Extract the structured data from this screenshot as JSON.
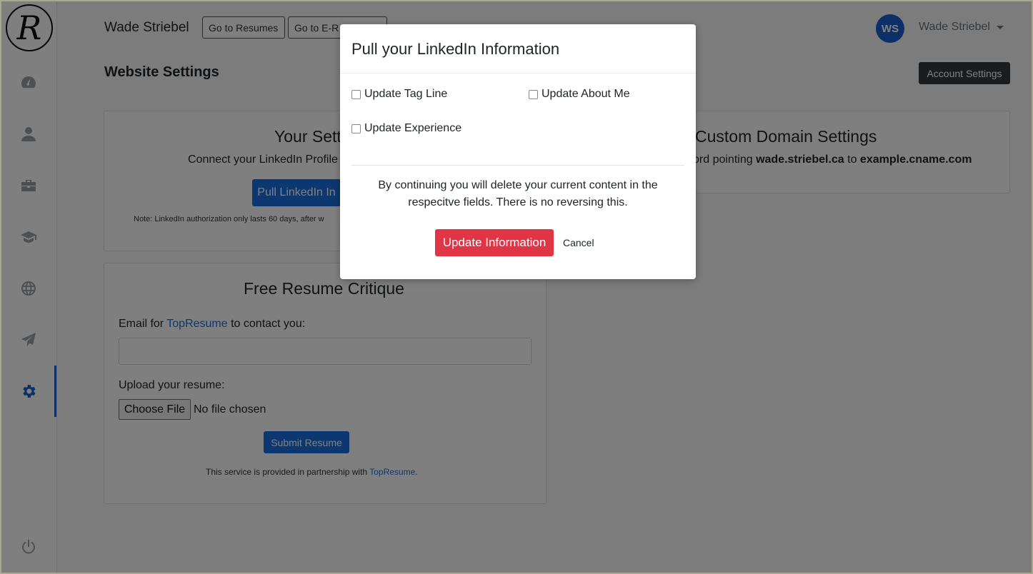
{
  "sidebar": {
    "logo_letter": "R",
    "items": [
      {
        "name": "dashboard",
        "icon": "gauge-icon"
      },
      {
        "name": "profile",
        "icon": "user-icon"
      },
      {
        "name": "experience",
        "icon": "briefcase-icon"
      },
      {
        "name": "education",
        "icon": "graduation-cap-icon"
      },
      {
        "name": "website",
        "icon": "globe-icon"
      },
      {
        "name": "send",
        "icon": "paper-plane-icon"
      },
      {
        "name": "settings",
        "icon": "gear-icon",
        "active": true
      },
      {
        "name": "logout",
        "icon": "power-icon"
      }
    ]
  },
  "header": {
    "brand": "Wade Striebel",
    "btn_resumes": "Go to Resumes",
    "btn_eresume": "Go to E-R",
    "avatar_initials": "WS",
    "user_name": "Wade Striebel"
  },
  "page": {
    "title": "Website Settings",
    "account_btn": "Account Settings"
  },
  "settings_card": {
    "title": "Your Sett",
    "text": "Connect your LinkedIn Profile",
    "button": "Pull LinkedIn In",
    "note": "Note: LinkedIn authorization only lasts 60 days, after w"
  },
  "domain_card": {
    "title": "Custom Domain Settings",
    "text_prefix": "ord pointing ",
    "domain": "wade.striebel.ca",
    "text_mid": " to ",
    "target": "example.cname.com"
  },
  "critique_card": {
    "title": "Free Resume Critique",
    "email_label_prefix": "Email for ",
    "email_label_link": "TopResume",
    "email_label_suffix": " to contact you:",
    "email_value": "",
    "upload_label": "Upload your resume:",
    "choose_file": "Choose File",
    "no_file": "No file chosen",
    "submit": "Submit Resume",
    "footer_prefix": "This service is provided in partnership with ",
    "footer_link": "TopResume",
    "footer_suffix": "."
  },
  "modal": {
    "title": "Pull your LinkedIn Information",
    "options": {
      "tag_line": "Update Tag Line",
      "about_me": "Update About Me",
      "experience": "Update Experience"
    },
    "warning": "By continuing you will delete your current content in the respecitve fields. There is no reversing this.",
    "confirm": "Update Information",
    "cancel": "Cancel"
  },
  "colors": {
    "primary": "#1a6fe0",
    "danger": "#e03545",
    "dark": "#343a40"
  }
}
